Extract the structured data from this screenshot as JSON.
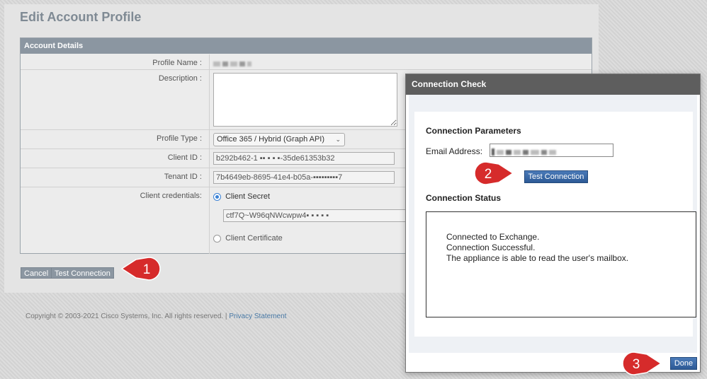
{
  "page": {
    "title": "Edit Account Profile",
    "section_header": "Account Details",
    "fields": {
      "profile_name_label": "Profile Name :",
      "description_label": "Description :",
      "profile_type_label": "Profile Type :",
      "profile_type_value": "Office 365 / Hybrid (Graph API)",
      "client_id_label": "Client ID :",
      "client_id_value": "b292b462-1 ▪▪ ▪ ▪ ▪-35de61353b32",
      "tenant_id_label": "Tenant ID :",
      "tenant_id_value": "7b4649eb-8695-41e4-b05a-▪▪▪▪▪▪▪▪▪7",
      "client_credentials_label": "Client credentials:",
      "client_secret_label": "Client Secret",
      "client_secret_value": "ctf7Q~W96qNWcwpw4▪ ▪ ▪ ▪ ▪",
      "client_certificate_label": "Client Certificate"
    },
    "buttons": {
      "cancel": "Cancel",
      "test_connection": "Test Connection"
    },
    "footer": {
      "copyright": "Copyright © 2003-2021 Cisco Systems, Inc. All rights reserved. |",
      "privacy_link": "Privacy Statement"
    }
  },
  "modal": {
    "title": "Connection Check",
    "params_title": "Connection Parameters",
    "email_label": "Email Address:",
    "test_button": "Test Connection",
    "status_title": "Connection Status",
    "status_lines": [
      "Connected to Exchange.",
      "Connection Successful.",
      "The appliance is able to read the user's mailbox."
    ],
    "done_button": "Done"
  },
  "callouts": [
    "1",
    "2",
    "3"
  ],
  "colors": {
    "callout_red": "#d62b2b",
    "header_grey": "#8b96a1",
    "modal_title": "#5e5e5e",
    "button_blue": "#2d5a96"
  }
}
